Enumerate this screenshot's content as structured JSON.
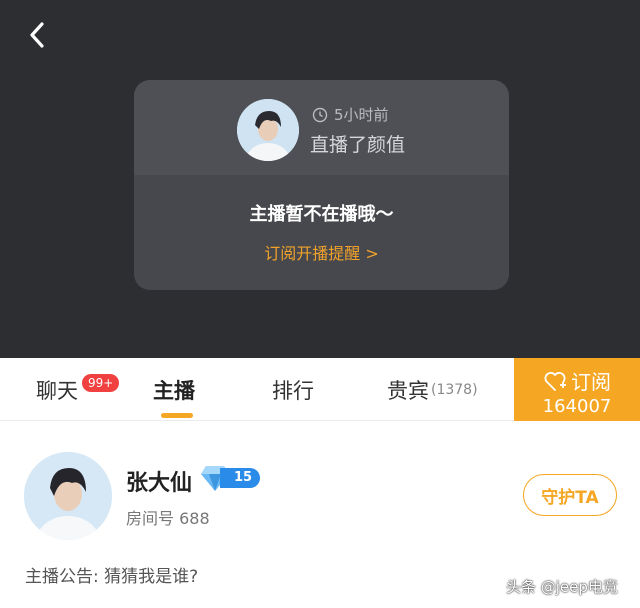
{
  "card": {
    "time": "5小时前",
    "desc": "直播了颜值",
    "offline_text": "主播暂不在播哦～",
    "subscribe_remind": "订阅开播提醒 >"
  },
  "tabs": {
    "chat": "聊天",
    "chat_badge": "99+",
    "host": "主播",
    "rank": "排行",
    "vip": "贵宾",
    "vip_count": "(1378)"
  },
  "subscribe": {
    "label": "订阅",
    "count": "164007"
  },
  "profile": {
    "name": "张大仙",
    "level": "15",
    "room": "房间号 688",
    "guard_label": "守护TA",
    "notice": "主播公告: 猜猜我是谁?"
  },
  "watermark": "头条 @jeep电竞",
  "colors": {
    "accent": "#f5a623",
    "dark_bg": "#2d2e32",
    "badge": "#f04040",
    "level": "#2b8be8"
  },
  "icons": {
    "back": "back-arrow-icon",
    "clock": "clock-icon",
    "heart_plus": "heart-plus-icon",
    "diamond": "diamond-icon"
  }
}
